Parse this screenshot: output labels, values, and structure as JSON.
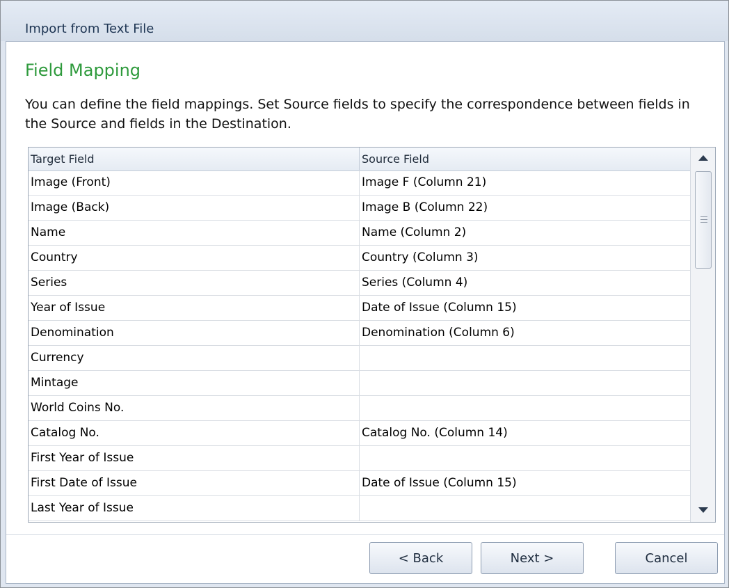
{
  "window": {
    "title": "Import from Text File"
  },
  "page": {
    "title": "Field Mapping",
    "description": "You can define the field mappings. Set Source fields to specify the correspondence between fields in the Source and fields in the Destination."
  },
  "grid": {
    "columns": [
      "Target Field",
      "Source Field"
    ],
    "rows": [
      {
        "target": "Image (Front)",
        "source": "Image F (Column 21)"
      },
      {
        "target": "Image (Back)",
        "source": "Image B (Column 22)"
      },
      {
        "target": "Name",
        "source": "Name (Column 2)"
      },
      {
        "target": "Country",
        "source": "Country (Column 3)"
      },
      {
        "target": "Series",
        "source": "Series (Column 4)"
      },
      {
        "target": "Year of Issue",
        "source": "Date of Issue (Column 15)"
      },
      {
        "target": "Denomination",
        "source": "Denomination (Column 6)"
      },
      {
        "target": "Currency",
        "source": ""
      },
      {
        "target": "Mintage",
        "source": ""
      },
      {
        "target": "World Coins No.",
        "source": ""
      },
      {
        "target": "Catalog No.",
        "source": "Catalog No. (Column 14)"
      },
      {
        "target": "First Year of Issue",
        "source": ""
      },
      {
        "target": "First Date of Issue",
        "source": "Date of Issue (Column 15)"
      },
      {
        "target": "Last Year of Issue",
        "source": ""
      }
    ]
  },
  "buttons": {
    "back": "< Back",
    "next": "Next >",
    "cancel": "Cancel"
  },
  "icons": {
    "scroll_up": "arrow-up-icon",
    "scroll_down": "arrow-down-icon",
    "thumb_grip": "grip-icon"
  }
}
